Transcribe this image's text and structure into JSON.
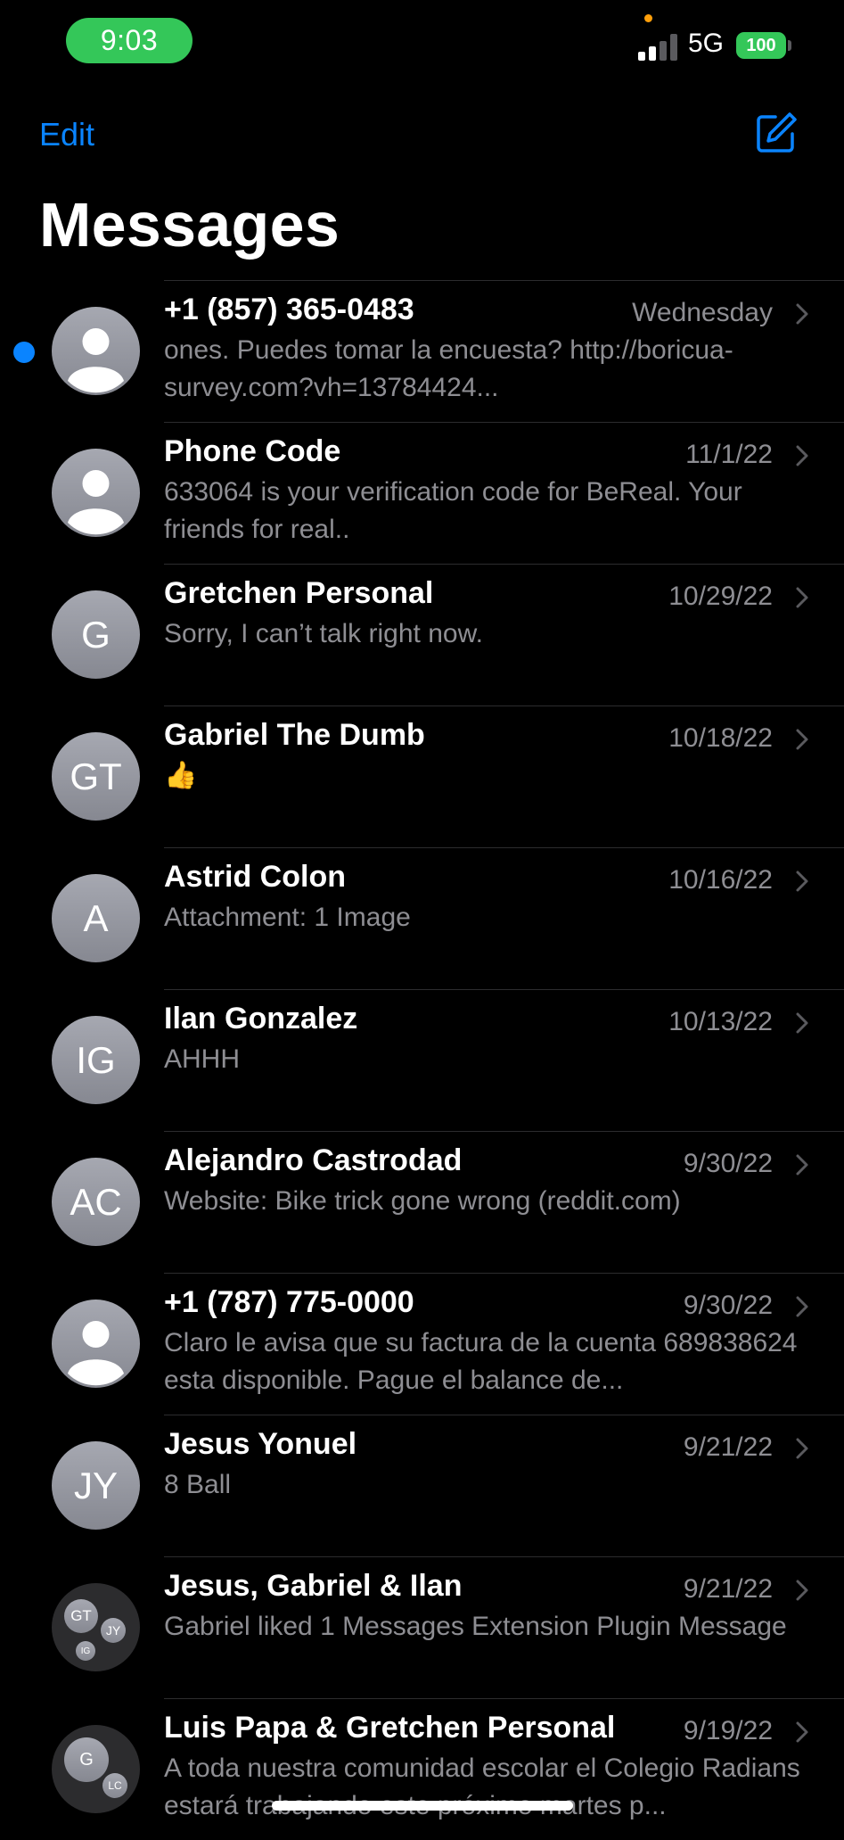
{
  "status_bar": {
    "time": "9:03",
    "network": "5G",
    "battery": "100"
  },
  "header": {
    "edit_label": "Edit",
    "title": "Messages",
    "compose_icon": "square-pencil-icon"
  },
  "conversations": [
    {
      "name": "+1 (857) 365-0483",
      "date": "Wednesday",
      "preview": "ones. Puedes tomar la encuesta?  http://boricua-survey.com?vh=13784424...",
      "avatar": "",
      "avatar_type": "person",
      "unread": true
    },
    {
      "name": "Phone Code",
      "date": "11/1/22",
      "preview": "633064 is your verification code for BeReal. Your friends for real..",
      "avatar": "",
      "avatar_type": "person",
      "unread": false
    },
    {
      "name": "Gretchen Personal",
      "date": "10/29/22",
      "preview": "Sorry, I can’t talk right now.",
      "avatar": "G",
      "avatar_type": "initials",
      "unread": false
    },
    {
      "name": "Gabriel The Dumb",
      "date": "10/18/22",
      "preview": "👍",
      "avatar": "GT",
      "avatar_type": "initials",
      "unread": false
    },
    {
      "name": "Astrid Colon",
      "date": "10/16/22",
      "preview": "Attachment: 1 Image",
      "avatar": "A",
      "avatar_type": "initials",
      "unread": false
    },
    {
      "name": "Ilan Gonzalez",
      "date": "10/13/22",
      "preview": "AHHH",
      "avatar": "IG",
      "avatar_type": "initials",
      "unread": false
    },
    {
      "name": "Alejandro Castrodad",
      "date": "9/30/22",
      "preview": "Website: Bike trick gone wrong (reddit.com)",
      "avatar": "AC",
      "avatar_type": "initials",
      "unread": false
    },
    {
      "name": "+1 (787) 775-0000",
      "date": "9/30/22",
      "preview": "Claro le avisa que su factura de la cuenta 689838624 esta disponible. Pague el balance de...",
      "avatar": "",
      "avatar_type": "person",
      "unread": false
    },
    {
      "name": "Jesus Yonuel",
      "date": "9/21/22",
      "preview": "8 Ball",
      "avatar": "JY",
      "avatar_type": "initials",
      "unread": false
    },
    {
      "name": "Jesus, Gabriel & Ilan",
      "date": "9/21/22",
      "preview": "Gabriel liked 1 Messages Extension Plugin Message",
      "avatar_type": "group3",
      "group_initials": [
        "GT",
        "JY",
        "IG"
      ],
      "unread": false
    },
    {
      "name": "Luis Papa & Gretchen Personal",
      "date": "9/19/22",
      "preview": "A toda nuestra comunidad escolar el Colegio Radians estará trabajando este próximo martes p...",
      "avatar_type": "group2",
      "group_initials": [
        "G",
        "LC"
      ],
      "unread": false
    }
  ]
}
